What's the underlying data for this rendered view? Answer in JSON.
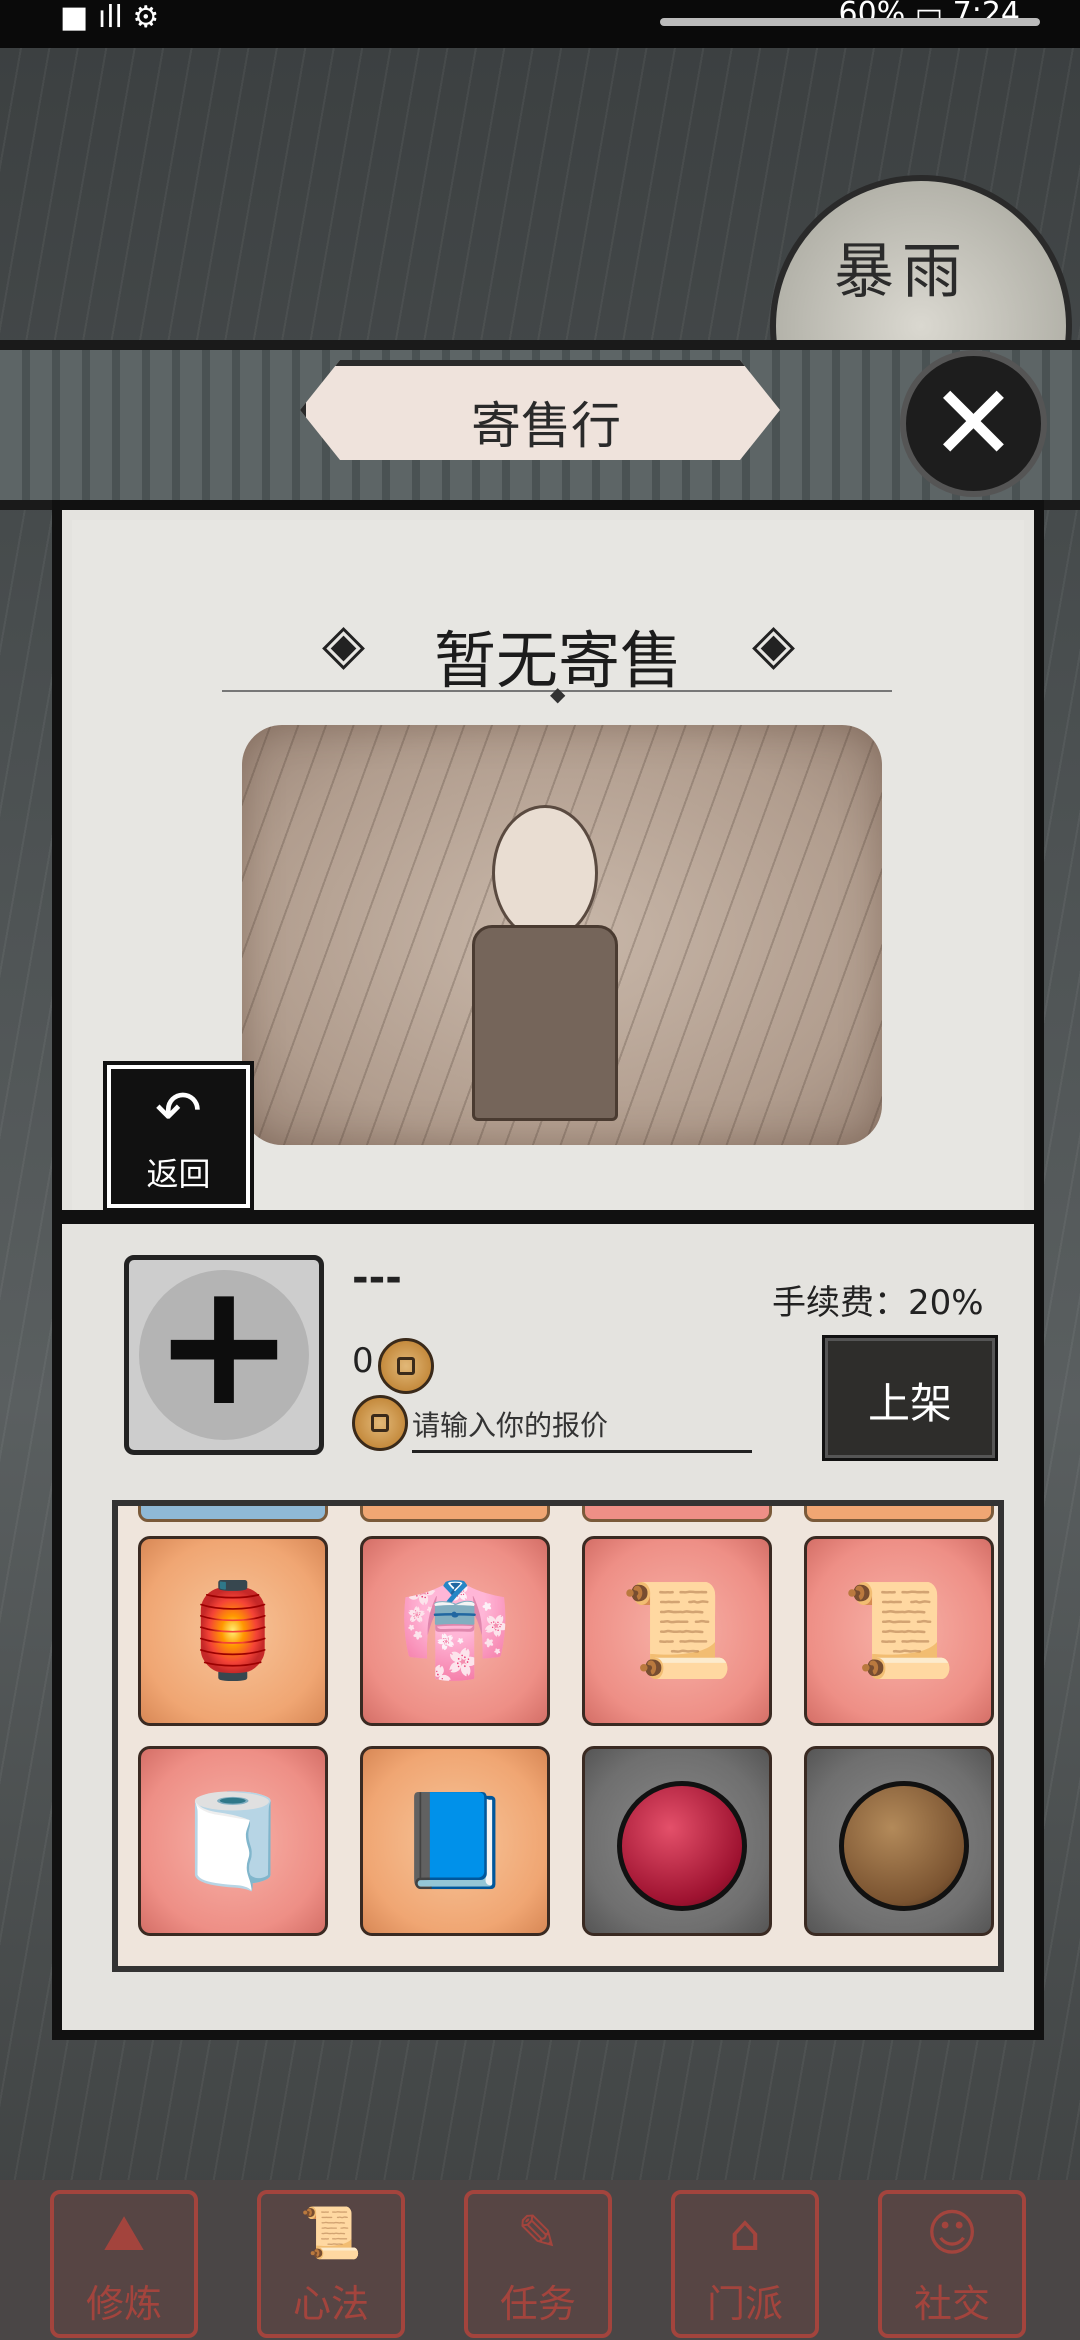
{
  "status_bar": {
    "left_icons": "■ ıll ⚙",
    "right_text": "60% ▭ 7:24"
  },
  "weather": {
    "label": "暴雨"
  },
  "title": "寄售行",
  "close_icon": "✕",
  "empty_state": {
    "title": "暂无寄售"
  },
  "back_button": {
    "label": "返回"
  },
  "item": {
    "name": "---",
    "price": "0"
  },
  "fee": {
    "label": "手续费：20%"
  },
  "price_input": {
    "placeholder": "请输入你的报价"
  },
  "shelve_button": {
    "label": "上架"
  },
  "inventory": {
    "items": [
      {
        "name": "lantern",
        "bg": "orange"
      },
      {
        "name": "robe",
        "bg": "red"
      },
      {
        "name": "scroll",
        "bg": "red"
      },
      {
        "name": "scroll",
        "bg": "red"
      },
      {
        "name": "jade-scroll",
        "bg": "red"
      },
      {
        "name": "book",
        "bg": "orange"
      },
      {
        "name": "crimson-orb",
        "bg": "gray"
      },
      {
        "name": "bronze-orb",
        "bg": "gray"
      }
    ]
  },
  "bottom_nav": [
    {
      "label": "修炼",
      "icon": "⛰"
    },
    {
      "label": "心法",
      "icon": "📜"
    },
    {
      "label": "任务",
      "icon": "✎"
    },
    {
      "label": "门派",
      "icon": "⌂"
    },
    {
      "label": "社交",
      "icon": "☺"
    }
  ],
  "colors": {
    "accent_red": "#a3443d",
    "panel_bg": "#e4e3df"
  }
}
